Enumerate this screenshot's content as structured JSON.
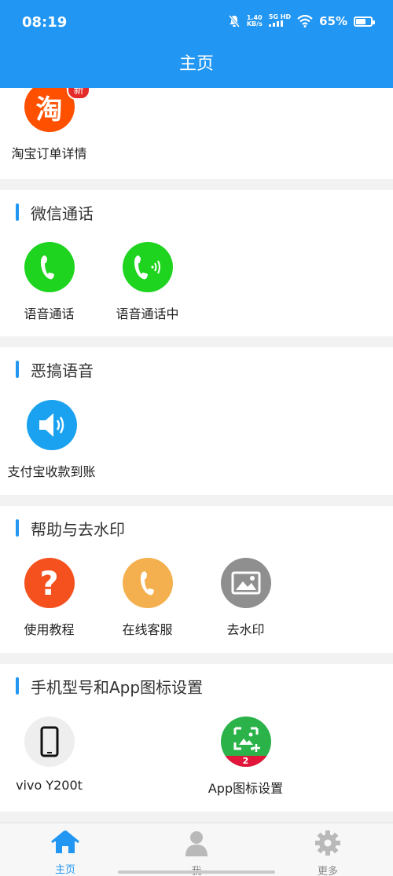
{
  "status_bar": {
    "time": "08:19",
    "speed_value": "1.40",
    "speed_unit": "KB/s",
    "network_top": "5G HD",
    "battery_percent": "65%",
    "battery_level": 0.65,
    "icons": [
      "mute-icon",
      "signal-icon",
      "wifi-icon",
      "battery-icon"
    ]
  },
  "header": {
    "title": "主页"
  },
  "sections": {
    "top": {
      "items": [
        {
          "label": "淘宝订单详情",
          "glyph": "淘",
          "badge": "新",
          "icon": "taobao-icon",
          "color": "#ff5000"
        }
      ]
    },
    "wechat": {
      "title": "微信通话",
      "items": [
        {
          "label": "语音通话",
          "icon": "phone-icon",
          "color": "#1ed41e"
        },
        {
          "label": "语音通话中",
          "icon": "phone-calling-icon",
          "color": "#1ed41e"
        }
      ]
    },
    "prank": {
      "title": "恶搞语音",
      "items": [
        {
          "label": "支付宝收款到账",
          "icon": "speaker-icon",
          "color": "#1aa2f0"
        }
      ]
    },
    "help": {
      "title": "帮助与去水印",
      "items": [
        {
          "label": "使用教程",
          "glyph": "?",
          "icon": "question-icon",
          "color": "#f4511e"
        },
        {
          "label": "在线客服",
          "icon": "customer-service-phone-icon",
          "color": "#f4b04f"
        },
        {
          "label": "去水印",
          "icon": "image-icon",
          "color": "#8f8f8f"
        }
      ]
    },
    "device": {
      "title": "手机型号和App图标设置",
      "items": [
        {
          "label": "vivo Y200t",
          "icon": "smartphone-icon",
          "color": "#eeeeee"
        },
        {
          "label": "App图标设置",
          "badge": "2",
          "icon": "app-icon-settings-icon",
          "color": "#2bb34a"
        }
      ]
    }
  },
  "tabbar": {
    "tabs": [
      {
        "label": "主页",
        "icon": "home-icon",
        "active": true
      },
      {
        "label": "我",
        "icon": "user-icon",
        "active": false
      },
      {
        "label": "更多",
        "icon": "gear-icon",
        "active": false
      }
    ],
    "active_color": "#2196F3"
  },
  "theme": {
    "primary": "#2196F3",
    "background": "#f2f2f2"
  }
}
